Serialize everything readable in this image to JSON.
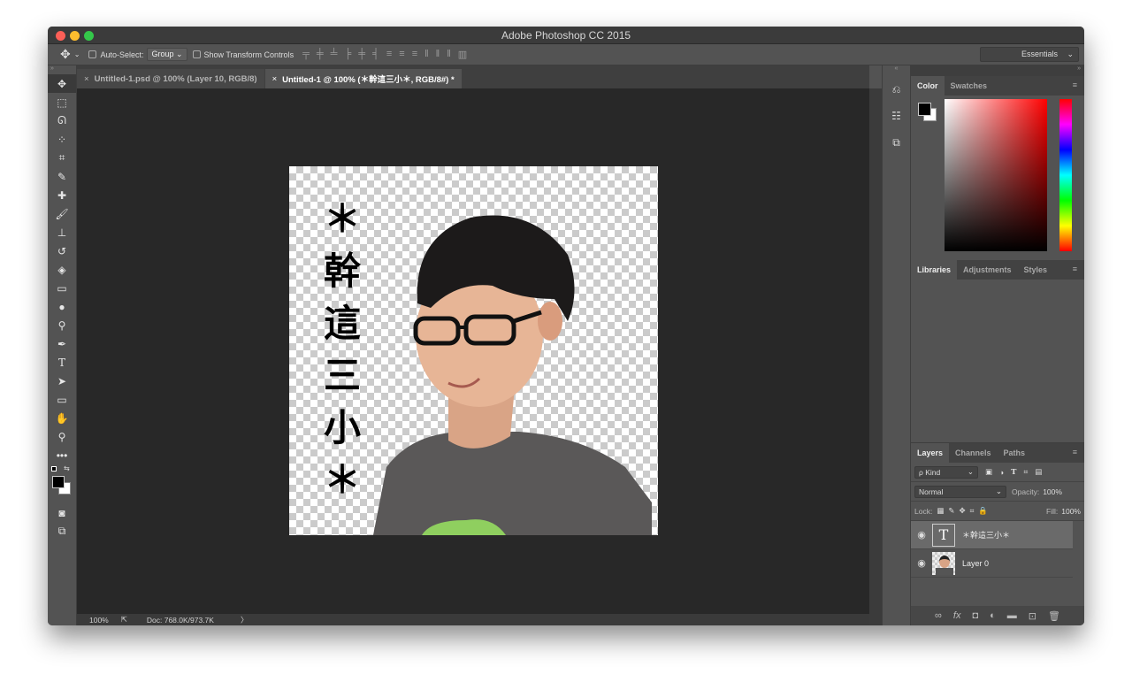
{
  "window": {
    "title": "Adobe Photoshop CC 2015"
  },
  "options_bar": {
    "move_tool_icon": "move-icon",
    "auto_select_label": "Auto-Select:",
    "auto_select_value": "Group",
    "transform_label": "Show Transform Controls",
    "workspace": "Essentials"
  },
  "tabs": [
    {
      "label": "Untitled-1.psd @ 100% (Layer 10, RGB/8)",
      "close": "×"
    },
    {
      "label": "Untitled-1 @ 100% (＊幹這三小＊, RGB/8#) *",
      "close": "×"
    }
  ],
  "canvas_text": [
    "＊",
    "幹",
    "這",
    "三",
    "小",
    "＊"
  ],
  "status_bar": {
    "zoom": "100%",
    "doc": "Doc: 768.0K/973.7K",
    "arrow": "〉"
  },
  "color_panel": {
    "tabs": [
      "Color",
      "Swatches"
    ]
  },
  "libraries_panel": {
    "tabs": [
      "Libraries",
      "Adjustments",
      "Styles"
    ]
  },
  "layers_panel": {
    "tabs": [
      "Layers",
      "Channels",
      "Paths"
    ],
    "filter": "ρ Kind",
    "blend_mode": "Normal",
    "opacity_label": "Opacity:",
    "opacity_value": "100%",
    "lock_label": "Lock:",
    "fill_label": "Fill:",
    "fill_value": "100%",
    "layers": [
      {
        "name": "＊幹這三小＊",
        "type": "text"
      },
      {
        "name": "Layer 0",
        "type": "image"
      }
    ]
  },
  "colors": {
    "foreground": "#000000",
    "background": "#ffffff",
    "accent": "#2a6ad8"
  }
}
